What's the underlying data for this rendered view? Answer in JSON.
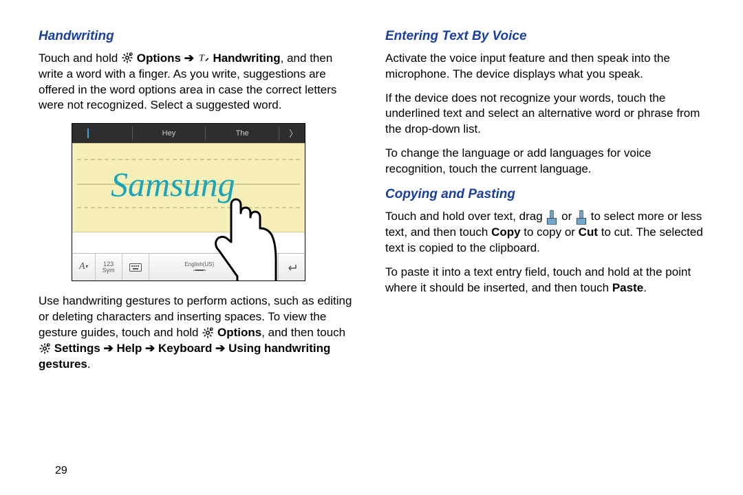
{
  "page_number": "29",
  "left": {
    "heading": "Handwriting",
    "p1_pre": "Touch and hold ",
    "p1_opts": "Options",
    "p1_arrow": " ➔ ",
    "p1_hand": "Handwriting",
    "p1_post": ", and then write a word with a finger. As you write, suggestions are offered in the word options area in case the correct letters were not recognized. Select a suggested word.",
    "p2_pre": "Use handwriting gestures to perform actions, such as editing or deleting characters and inserting spaces. To view the gesture guides, touch and hold ",
    "p2_opts": "Options",
    "p2_post": ", and then touch ",
    "p2_path": "Settings ➔ Help ➔ Keyboard ➔ Using handwriting gestures",
    "p2_end": ".",
    "illustration": {
      "suggestion1": "Hey",
      "suggestion2": "The",
      "word": "Samsung",
      "sym_label": "123\nSym",
      "lang_label": "English(US)"
    }
  },
  "right": {
    "voice_heading": "Entering Text By Voice",
    "voice_p1": "Activate the voice input feature and then speak into the microphone. The device displays what you speak.",
    "voice_p2": "If the device does not recognize your words, touch the underlined text and select an alternative word or phrase from the drop-down list.",
    "voice_p3": "To change the language or add languages for voice recognition, touch the current language.",
    "copy_heading": "Copying and Pasting",
    "copy_p1_pre": "Touch and hold over text, drag ",
    "copy_p1_mid": " or ",
    "copy_p1_post1": " to select more or less text, and then touch ",
    "copy_p1_copy": "Copy",
    "copy_p1_or": " to copy or ",
    "copy_p1_cut": "Cut",
    "copy_p1_end": " to cut. The selected text is copied to the clipboard.",
    "copy_p2_pre": "To paste it into a text entry field, touch and hold at the point where it should be inserted, and then touch ",
    "copy_p2_paste": "Paste",
    "copy_p2_end": "."
  }
}
